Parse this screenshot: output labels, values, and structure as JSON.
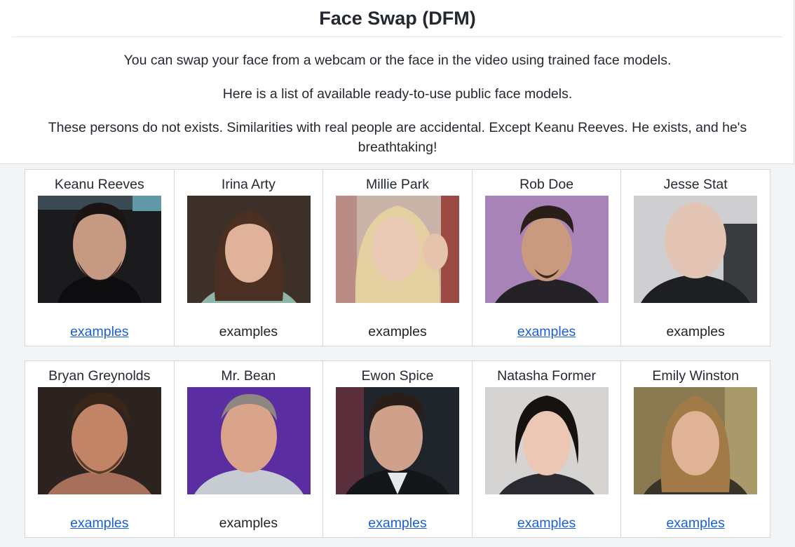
{
  "header": {
    "title": "Face Swap (DFM)",
    "descriptions": [
      "You can swap your face from a webcam or the face in the video using trained face models.",
      "Here is a list of available ready-to-use public face models.",
      "These persons do not exists. Similarities with real people are accidental. Except Keanu Reeves. He exists, and he's breathtaking!"
    ]
  },
  "models": [
    {
      "name": "Keanu Reeves",
      "examples": "examples",
      "examples_is_link": true
    },
    {
      "name": "Irina Arty",
      "examples": "examples",
      "examples_is_link": false
    },
    {
      "name": "Millie Park",
      "examples": "examples",
      "examples_is_link": false
    },
    {
      "name": "Rob Doe",
      "examples": "examples",
      "examples_is_link": true
    },
    {
      "name": "Jesse Stat",
      "examples": "examples",
      "examples_is_link": false
    },
    {
      "name": "Bryan Greynolds",
      "examples": "examples",
      "examples_is_link": true
    },
    {
      "name": "Mr. Bean",
      "examples": "examples",
      "examples_is_link": false
    },
    {
      "name": "Ewon Spice",
      "examples": "examples",
      "examples_is_link": true
    },
    {
      "name": "Natasha Former",
      "examples": "examples",
      "examples_is_link": true
    },
    {
      "name": "Emily Winston",
      "examples": "examples",
      "examples_is_link": true
    }
  ],
  "colors": {
    "link": "#1a5fd8",
    "border": "#d5d9de",
    "page_background": "#f3f4f6"
  }
}
